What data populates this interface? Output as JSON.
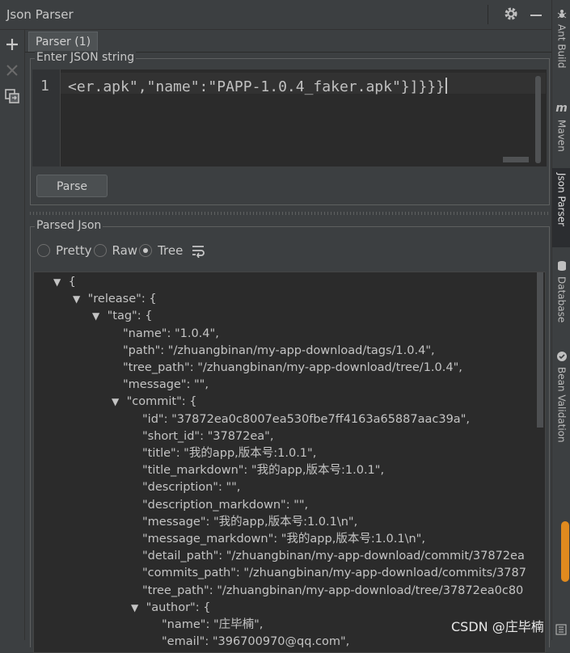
{
  "window": {
    "title": "Json Parser"
  },
  "tabs": [
    {
      "label": "Parser (1)"
    }
  ],
  "input_group": {
    "title": "Enter JSON string",
    "line_number": "1",
    "code": "<er.apk\",\"name\":\"PAPP-1.0.4_faker.apk\"}]}}}",
    "parse_button": "Parse"
  },
  "output_group": {
    "title": "Parsed Json",
    "modes": [
      {
        "label": "Pretty",
        "selected": false
      },
      {
        "label": "Raw",
        "selected": false
      },
      {
        "label": "Tree",
        "selected": true
      }
    ]
  },
  "tree_lines": [
    {
      "text": "{",
      "arrow": "▼"
    },
    {
      "text": "\"release\": {",
      "arrow": "▼"
    },
    {
      "text": "\"tag\": {",
      "arrow": "▼"
    },
    {
      "text": "\"name\": \"1.0.4\",",
      "arrow": ""
    },
    {
      "text": "\"path\": \"/zhuangbinan/my-app-download/tags/1.0.4\",",
      "arrow": ""
    },
    {
      "text": "\"tree_path\": \"/zhuangbinan/my-app-download/tree/1.0.4\",",
      "arrow": ""
    },
    {
      "text": "\"message\": \"\",",
      "arrow": ""
    },
    {
      "text": "\"commit\": {",
      "arrow": "▼"
    },
    {
      "text": "\"id\": \"37872ea0c8007ea530fbe7ff4163a65887aac39a\",",
      "arrow": ""
    },
    {
      "text": "\"short_id\": \"37872ea\",",
      "arrow": ""
    },
    {
      "text": "\"title\": \"我的app,版本号:1.0.1\",",
      "arrow": ""
    },
    {
      "text": "\"title_markdown\": \"我的app,版本号:1.0.1\",",
      "arrow": ""
    },
    {
      "text": "\"description\": \"\",",
      "arrow": ""
    },
    {
      "text": "\"description_markdown\": \"\",",
      "arrow": ""
    },
    {
      "text": "\"message\": \"我的app,版本号:1.0.1\\n\",",
      "arrow": ""
    },
    {
      "text": "\"message_markdown\": \"我的app,版本号:1.0.1\\n\",",
      "arrow": ""
    },
    {
      "text": "\"detail_path\": \"/zhuangbinan/my-app-download/commit/37872ea",
      "arrow": ""
    },
    {
      "text": "\"commits_path\": \"/zhuangbinan/my-app-download/commits/3787",
      "arrow": ""
    },
    {
      "text": "\"tree_path\": \"/zhuangbinan/my-app-download/tree/37872ea0c80",
      "arrow": ""
    },
    {
      "text": "\"author\": {",
      "arrow": "▼"
    },
    {
      "text": "\"name\": \"庄毕楠\",",
      "arrow": ""
    },
    {
      "text": "\"email\": \"396700970@qq.com\",",
      "arrow": ""
    }
  ],
  "right_tabs": [
    {
      "label": "Ant Build",
      "icon": "ant-icon"
    },
    {
      "label": "Maven",
      "icon": "maven-icon"
    },
    {
      "label": "Json Parser",
      "icon": ""
    },
    {
      "label": "Database",
      "icon": "database-icon"
    },
    {
      "label": "Bean Validation",
      "icon": "bean-validation-icon"
    }
  ],
  "watermark": "CSDN @庄毕楠",
  "colors": {
    "accent": "#e08a1e",
    "background": "#3c3f41",
    "editor": "#2b2b2b"
  }
}
